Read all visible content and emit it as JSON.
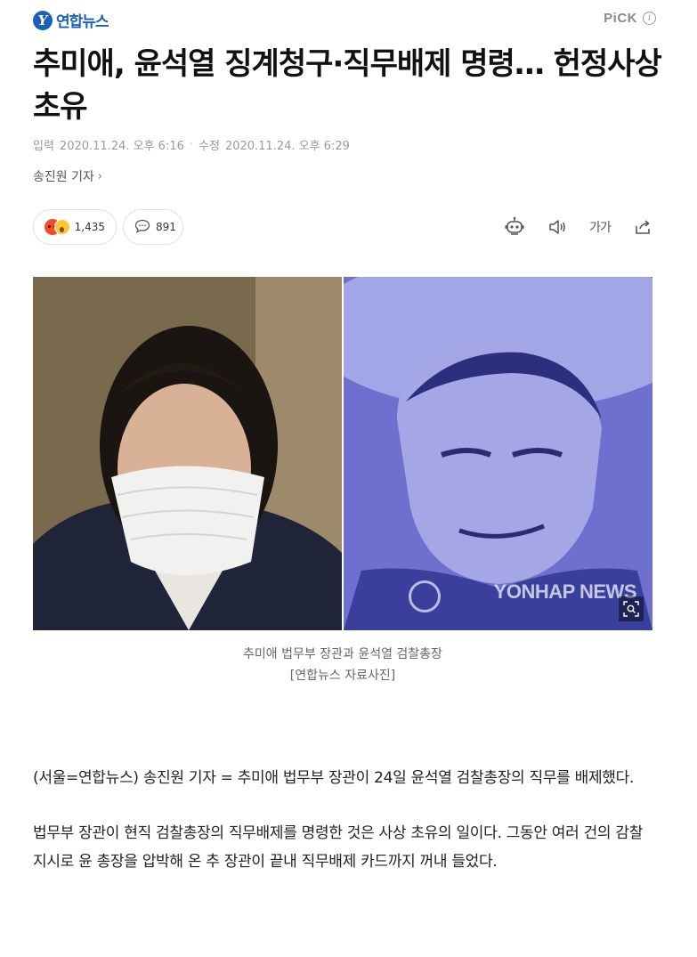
{
  "header": {
    "brand_name": "연합뉴스",
    "brand_logo_letter": "Y",
    "pick_label": "PiCK",
    "pick_info_icon": "i"
  },
  "article": {
    "headline": "추미애, 윤석열 징계청구·직무배제 명령… 헌정사상 초유",
    "input_label": "입력",
    "input_time": "2020.11.24. 오후 6:16",
    "modified_label": "수정",
    "modified_time": "2020.11.24. 오후 6:29",
    "reporter": "송진원 기자",
    "reaction_count": "1,435",
    "comment_count": "891",
    "font_tool_label": "가가",
    "photo_watermark": "YONHAP NEWS",
    "caption_line1": "추미애 법무부 장관과 윤석열 검찰총장",
    "caption_line2": "[연합뉴스 자료사진]",
    "paragraphs": [
      "(서울=연합뉴스) 송진원 기자 = 추미애 법무부 장관이 24일 윤석열 검찰총장의 직무를 배제했다.",
      "법무부 장관이 현직 검찰총장의 직무배제를 명령한 것은 사상 초유의 일이다. 그동안 여러 건의 감찰 지시로 윤 총장을 압박해 온 추 장관이 끝내 직무배제 카드까지 꺼내 들었다."
    ]
  },
  "colors": {
    "brand": "#1c5fb8",
    "angry_emoji": "#f04a2f",
    "shock_emoji": "#ffc630"
  },
  "icons": [
    "brand-logo-icon",
    "info-icon",
    "chevron-right-icon",
    "angry-emoji-icon",
    "surprised-emoji-icon",
    "comment-icon",
    "robot-tts-icon",
    "speaker-icon",
    "font-size-icon",
    "share-icon",
    "zoom-icon"
  ]
}
